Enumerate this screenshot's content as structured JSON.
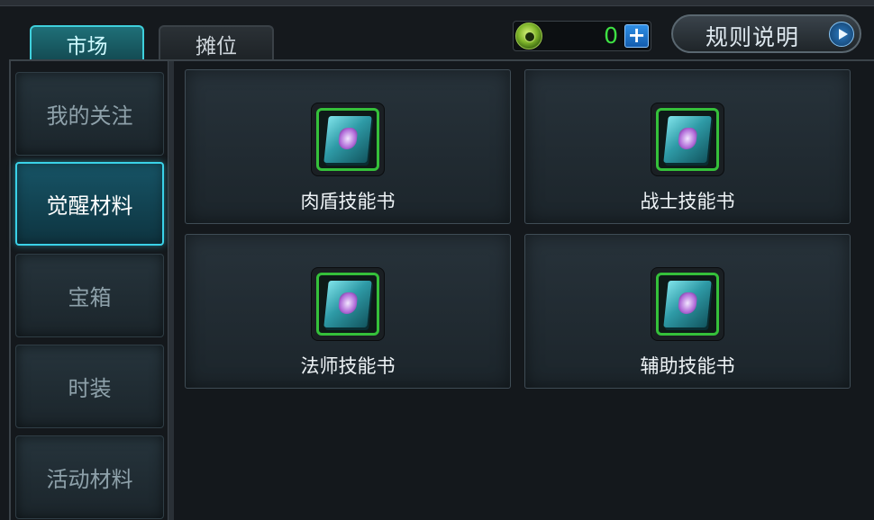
{
  "tabs": [
    {
      "label": "市场",
      "active": true
    },
    {
      "label": "摊位",
      "active": false
    }
  ],
  "currency": {
    "value": "0",
    "plus": "+"
  },
  "rules_button": {
    "label": "规则说明"
  },
  "sidebar": {
    "items": [
      {
        "label": "我的关注",
        "active": false
      },
      {
        "label": "觉醒材料",
        "active": true
      },
      {
        "label": "宝箱",
        "active": false
      },
      {
        "label": "时装",
        "active": false
      },
      {
        "label": "活动材料",
        "active": false
      }
    ]
  },
  "items": [
    {
      "label": "肉盾技能书",
      "icon": "skill-book-icon"
    },
    {
      "label": "战士技能书",
      "icon": "skill-book-icon"
    },
    {
      "label": "法师技能书",
      "icon": "skill-book-icon"
    },
    {
      "label": "辅助技能书",
      "icon": "skill-book-icon"
    }
  ],
  "colors": {
    "accent": "#3ad2e8",
    "currency_text": "#3ee043",
    "icon_border": "#35c03a"
  }
}
